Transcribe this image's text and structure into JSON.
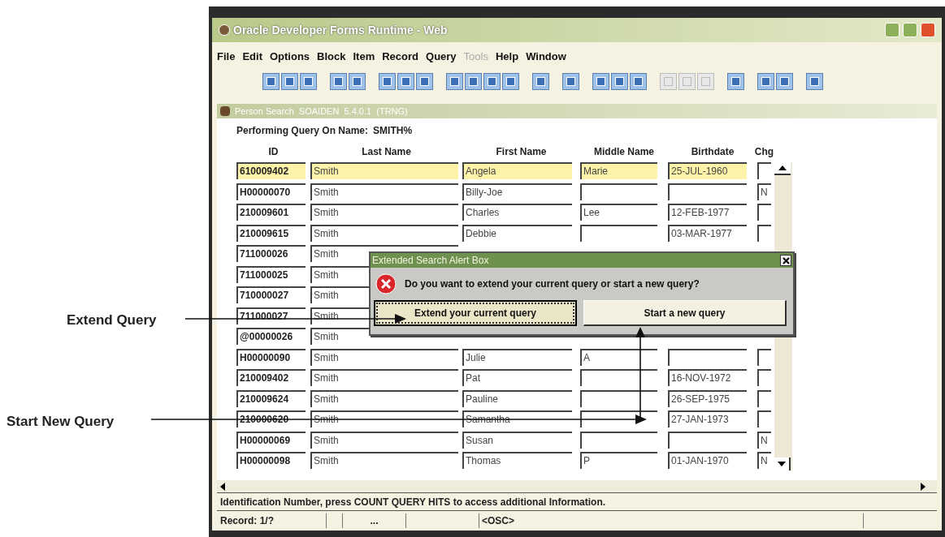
{
  "callouts": [
    {
      "label": "Extend Query"
    },
    {
      "label": "Start New Query"
    }
  ],
  "window": {
    "title": "Oracle Developer Forms Runtime - Web"
  },
  "menu": [
    {
      "label": "File",
      "disabled": false
    },
    {
      "label": "Edit",
      "disabled": false
    },
    {
      "label": "Options",
      "disabled": false
    },
    {
      "label": "Block",
      "disabled": false
    },
    {
      "label": "Item",
      "disabled": false
    },
    {
      "label": "Record",
      "disabled": false
    },
    {
      "label": "Query",
      "disabled": false
    },
    {
      "label": "Tools",
      "disabled": true
    },
    {
      "label": "Help",
      "disabled": false
    },
    {
      "label": "Window",
      "disabled": false
    }
  ],
  "toolbar_groups": [
    {
      "buttons": [
        {
          "disabled": false
        },
        {
          "disabled": false
        },
        {
          "disabled": false
        }
      ]
    },
    {
      "buttons": [
        {
          "disabled": false
        },
        {
          "disabled": false
        }
      ]
    },
    {
      "buttons": [
        {
          "disabled": false
        },
        {
          "disabled": false
        },
        {
          "disabled": false
        }
      ]
    },
    {
      "buttons": [
        {
          "disabled": false
        },
        {
          "disabled": false
        },
        {
          "disabled": false
        },
        {
          "disabled": false
        }
      ]
    },
    {
      "buttons": [
        {
          "disabled": false
        }
      ]
    },
    {
      "buttons": [
        {
          "disabled": false
        }
      ]
    },
    {
      "buttons": [
        {
          "disabled": false
        },
        {
          "disabled": false
        },
        {
          "disabled": false
        }
      ]
    },
    {
      "buttons": [
        {
          "disabled": true
        },
        {
          "disabled": true
        },
        {
          "disabled": true
        }
      ]
    },
    {
      "buttons": [
        {
          "disabled": false
        }
      ]
    },
    {
      "buttons": [
        {
          "disabled": false
        },
        {
          "disabled": false
        }
      ]
    },
    {
      "buttons": [
        {
          "disabled": false
        }
      ]
    }
  ],
  "form": {
    "title": "Person Search  SOAIDEN  5.4.0.1  (TRNG)",
    "query_label": "Performing Query On Name:",
    "query_value": "SMITH%",
    "columns": [
      "ID",
      "Last Name",
      "First Name",
      "Middle Name",
      "Birthdate",
      "Chg"
    ],
    "rows": [
      {
        "selected": true,
        "cells": [
          "610009402",
          "Smith",
          "Angela",
          "Marie",
          "25-JUL-1960",
          ""
        ]
      },
      {
        "selected": false,
        "cells": [
          "H00000070",
          "Smith",
          "Billy-Joe",
          "",
          "",
          "N"
        ]
      },
      {
        "selected": false,
        "cells": [
          "210009601",
          "Smith",
          "Charles",
          "Lee",
          "12-FEB-1977",
          ""
        ]
      },
      {
        "selected": false,
        "cells": [
          "210009615",
          "Smith",
          "Debbie",
          "",
          "03-MAR-1977",
          ""
        ]
      },
      {
        "selected": false,
        "cells": [
          "711000026",
          "Smith"
        ]
      },
      {
        "selected": false,
        "cells": [
          "711000025",
          "Smith"
        ]
      },
      {
        "selected": false,
        "cells": [
          "710000027",
          "Smith"
        ]
      },
      {
        "selected": false,
        "cells": [
          "711000027",
          "Smith"
        ]
      },
      {
        "selected": false,
        "cells": [
          "@00000026",
          "Smith"
        ]
      },
      {
        "selected": false,
        "cells": [
          "H00000090",
          "Smith",
          "Julie",
          "A",
          "",
          ""
        ]
      },
      {
        "selected": false,
        "cells": [
          "210009402",
          "Smith",
          "Pat",
          "",
          "16-NOV-1972",
          ""
        ]
      },
      {
        "selected": false,
        "cells": [
          "210009624",
          "Smith",
          "Pauline",
          "",
          "26-SEP-1975",
          ""
        ]
      },
      {
        "selected": false,
        "cells": [
          "210000620",
          "Smith",
          "Samantha",
          "",
          "27-JAN-1973",
          ""
        ]
      },
      {
        "selected": false,
        "cells": [
          "H00000069",
          "Smith",
          "Susan",
          "",
          "",
          "N"
        ]
      },
      {
        "selected": false,
        "cells": [
          "H00000098",
          "Smith",
          "Thomas",
          "P",
          "01-JAN-1970",
          "N"
        ]
      }
    ]
  },
  "hint": "Identification Number, press COUNT QUERY HITS to access additional Information.",
  "status_bar": [
    "Record: 1/?",
    "...",
    "<OSC>"
  ],
  "dialog": {
    "title": "Extended Search Alert Box",
    "message": "Do you want to extend your current query or start a new query?",
    "buttons": [
      {
        "label": "Extend your current query",
        "selected": true
      },
      {
        "label": "Start a new query",
        "selected": false
      }
    ]
  }
}
